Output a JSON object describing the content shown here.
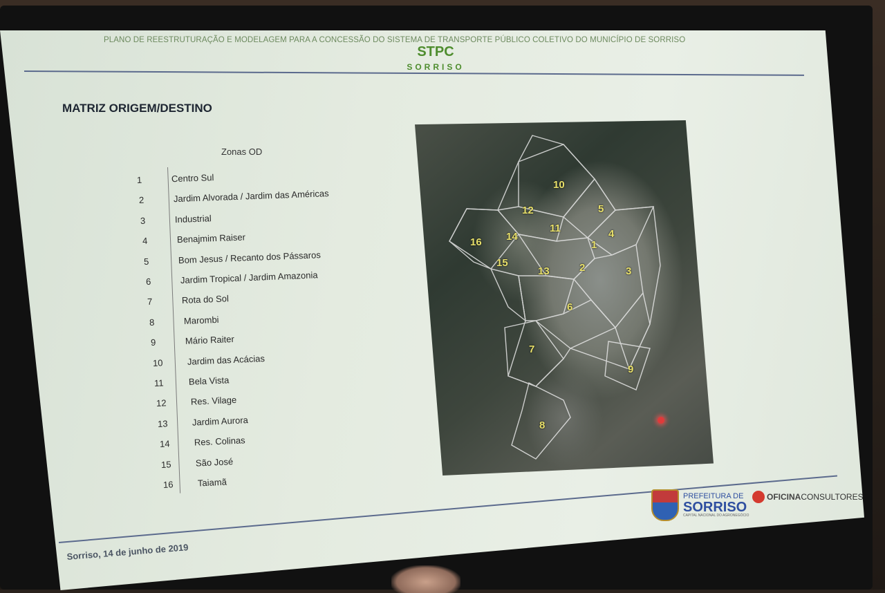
{
  "header": {
    "plan_title": "PLANO DE REESTRUTURAÇÃO E MODELAGEM PARA A CONCESSÃO DO SISTEMA DE TRANSPORTE PÚBLICO COLETIVO DO MUNICÍPIO DE SORRISO",
    "stpc": "STPC",
    "sorriso": "SORRISO"
  },
  "slide_title": "MATRIZ ORIGEM/DESTINO",
  "zones_header": "Zonas OD",
  "zones": [
    {
      "num": "1",
      "name": "Centro Sul"
    },
    {
      "num": "2",
      "name": "Jardim Alvorada / Jardim das Américas"
    },
    {
      "num": "3",
      "name": "Industrial"
    },
    {
      "num": "4",
      "name": "Benajmim Raiser"
    },
    {
      "num": "5",
      "name": "Bom Jesus / Recanto dos Pássaros"
    },
    {
      "num": "6",
      "name": "Jardim Tropical / Jardim Amazonia"
    },
    {
      "num": "7",
      "name": "Rota do Sol"
    },
    {
      "num": "8",
      "name": "Marombi"
    },
    {
      "num": "9",
      "name": "Mário Raiter"
    },
    {
      "num": "10",
      "name": "Jardim das Acácias"
    },
    {
      "num": "11",
      "name": "Bela Vista"
    },
    {
      "num": "12",
      "name": "Res. Vilage"
    },
    {
      "num": "13",
      "name": "Jardim Aurora"
    },
    {
      "num": "14",
      "name": "Res. Colinas"
    },
    {
      "num": "15",
      "name": "São José"
    },
    {
      "num": "16",
      "name": "Taiamã"
    }
  ],
  "map_labels": [
    "10",
    "12",
    "5",
    "11",
    "4",
    "16",
    "14",
    "1",
    "15",
    "13",
    "2",
    "3",
    "6",
    "7",
    "9",
    "8"
  ],
  "footer": {
    "date": "Sorriso, 14 de junho de 2019",
    "pref_line1": "PREFEITURA DE",
    "pref_line2": "SORRISO",
    "pref_line3": "CAPITAL NACIONAL DO AGRONEGÓCIO",
    "oficina_bold": "OFICINA",
    "oficina_rest": "CONSULTORES"
  },
  "colors": {
    "brand_green": "#4e8d2e",
    "rule_blue": "#5b6a8d",
    "map_label": "#e8e06a"
  }
}
